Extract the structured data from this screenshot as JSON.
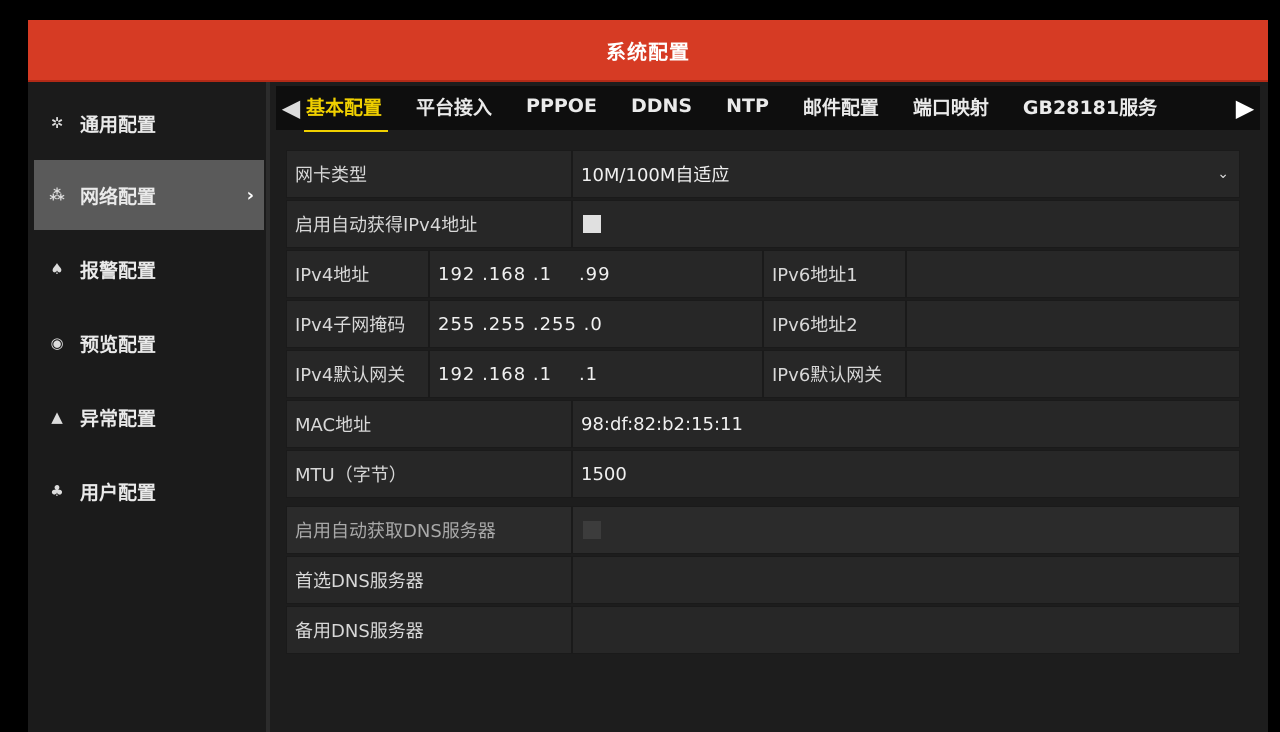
{
  "window": {
    "title": "系统配置"
  },
  "sidebar": {
    "items": [
      {
        "label": "通用配置",
        "icon": "gear-icon",
        "glyph": "✲",
        "active": false
      },
      {
        "label": "网络配置",
        "icon": "network-icon",
        "glyph": "⁂",
        "active": true
      },
      {
        "label": "报警配置",
        "icon": "alarm-icon",
        "glyph": "♠",
        "active": false
      },
      {
        "label": "预览配置",
        "icon": "eye-icon",
        "glyph": "◉",
        "active": false
      },
      {
        "label": "异常配置",
        "icon": "warning-icon",
        "glyph": "▲",
        "active": false
      },
      {
        "label": "用户配置",
        "icon": "users-icon",
        "glyph": "♣",
        "active": false
      }
    ],
    "active_chevron": "›"
  },
  "tabs": {
    "left_arrow": "◀",
    "right_arrow": "▶",
    "items": [
      "基本配置",
      "平台接入",
      "PPPOE",
      "DDNS",
      "NTP",
      "邮件配置",
      "端口映射",
      "GB28181服务"
    ],
    "active_index": 0
  },
  "form": {
    "nic_type": {
      "label": "网卡类型",
      "value": "10M/100M自适应",
      "dropdown_glyph": "⌄"
    },
    "auto_ipv4": {
      "label": "启用自动获得IPv4地址",
      "checked": false
    },
    "ipv4_address": {
      "label": "IPv4地址",
      "value": "192 .168 .1    .99"
    },
    "ipv6_address1": {
      "label": "IPv6地址1",
      "value": ""
    },
    "ipv4_mask": {
      "label": "IPv4子网掩码",
      "value": "255 .255 .255 .0"
    },
    "ipv6_address2": {
      "label": "IPv6地址2",
      "value": ""
    },
    "ipv4_gateway": {
      "label": "IPv4默认网关",
      "value": "192 .168 .1    .1"
    },
    "ipv6_gateway": {
      "label": "IPv6默认网关",
      "value": ""
    },
    "mac": {
      "label": "MAC地址",
      "value": "98:df:82:b2:15:11"
    },
    "mtu": {
      "label": "MTU（字节）",
      "value": "1500"
    },
    "auto_dns": {
      "label": "启用自动获取DNS服务器",
      "checked": false
    },
    "preferred_dns": {
      "label": "首选DNS服务器",
      "value": ""
    },
    "alternate_dns": {
      "label": "备用DNS服务器",
      "value": ""
    }
  },
  "colors": {
    "title_bar": "#d63b24",
    "active_tab": "#f0d000",
    "active_sidebar": "#5a5a5a"
  }
}
